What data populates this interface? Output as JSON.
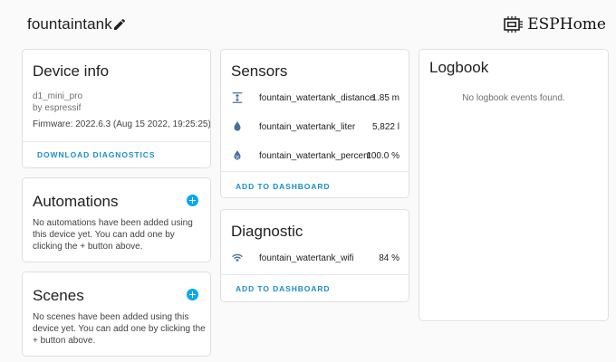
{
  "header": {
    "device_name": "fountaintank",
    "brand": "ESPHome"
  },
  "device_info": {
    "title": "Device info",
    "model": "d1_mini_pro",
    "manufacturer": "by espressif",
    "firmware": "Firmware: 2022.6.3 (Aug 15 2022, 19:25:25)",
    "action": "DOWNLOAD DIAGNOSTICS"
  },
  "automations": {
    "title": "Automations",
    "text": "No automations have been added using this device yet. You can add one by clicking the + button above."
  },
  "scenes": {
    "title": "Scenes",
    "text": "No scenes have been added using this device yet. You can add one by clicking the + button above."
  },
  "sensors": {
    "title": "Sensors",
    "items": [
      {
        "name": "fountain_watertank_distance",
        "value": "1.85 m",
        "icon": "arrow-expand-vertical-icon"
      },
      {
        "name": "fountain_watertank_liter",
        "value": "5,822 l",
        "icon": "water-drop-icon"
      },
      {
        "name": "fountain_watertank_percent",
        "value": "100.0 %",
        "icon": "water-percent-icon"
      }
    ],
    "action": "ADD TO DASHBOARD"
  },
  "diagnostic": {
    "title": "Diagnostic",
    "items": [
      {
        "name": "fountain_watertank_wifi",
        "value": "84 %",
        "icon": "wifi-icon"
      }
    ],
    "action": "ADD TO DASHBOARD"
  },
  "logbook": {
    "title": "Logbook",
    "empty_text": "No logbook events found."
  },
  "colors": {
    "accent": "#03a9f4",
    "link": "#1a8dd0",
    "icon": "#44739e"
  }
}
